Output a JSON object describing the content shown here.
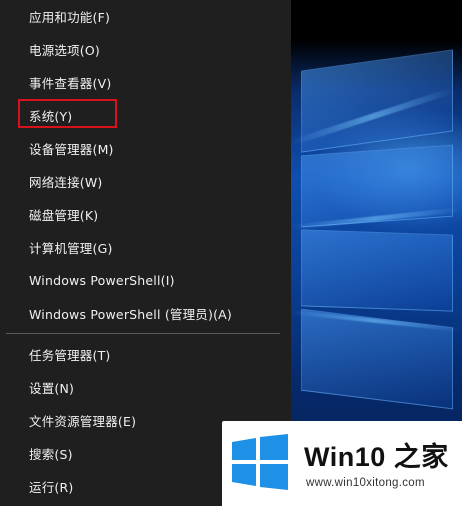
{
  "menu": {
    "items": [
      {
        "label": "应用和功能(F)"
      },
      {
        "label": "电源选项(O)"
      },
      {
        "label": "事件查看器(V)"
      },
      {
        "label": "系统(Y)"
      },
      {
        "label": "设备管理器(M)"
      },
      {
        "label": "网络连接(W)"
      },
      {
        "label": "磁盘管理(K)"
      },
      {
        "label": "计算机管理(G)"
      },
      {
        "label": "Windows PowerShell(I)"
      },
      {
        "label": "Windows PowerShell (管理员)(A)"
      },
      {
        "label": "任务管理器(T)"
      },
      {
        "label": "设置(N)"
      },
      {
        "label": "文件资源管理器(E)"
      },
      {
        "label": "搜索(S)"
      },
      {
        "label": "运行(R)"
      }
    ],
    "highlighted_item": "系统(Y)",
    "highlight_color": "#d8121b"
  },
  "watermark": {
    "title": "Win10 之家",
    "url": "www.win10xitong.com",
    "logo_color": "#1e90e6"
  },
  "colors": {
    "menu_background": "#1f1f1f",
    "menu_text": "#f0f0f0",
    "desktop_accent": "#0f4fb0"
  }
}
